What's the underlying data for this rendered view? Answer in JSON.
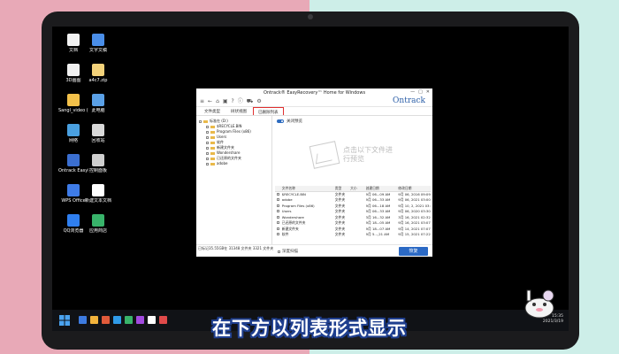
{
  "desktop": {
    "icons": [
      {
        "label": "文档",
        "color": "#f2f2f2"
      },
      {
        "label": "文字文稿",
        "color": "#4a8ee8"
      },
      {
        "label": "3D画图",
        "color": "#f0f0f0"
      },
      {
        "label": "a4c7.zip",
        "color": "#f3d27a"
      },
      {
        "label": "Sangl_video (192.168.1...",
        "color": "#f3c14a"
      },
      {
        "label": "此电脑",
        "color": "#5aa0e6"
      },
      {
        "label": "网络",
        "color": "#4aa0e0"
      },
      {
        "label": "回收站",
        "color": "#d8d8d8"
      },
      {
        "label": "Ontrack EasyReco...",
        "color": "#3b6fd0"
      },
      {
        "label": "控制面板",
        "color": "#cfcfcf"
      },
      {
        "label": "WPS Office",
        "color": "#3e7ce8"
      },
      {
        "label": "新建文本文档",
        "color": "#ffffff"
      },
      {
        "label": "QQ浏览器",
        "color": "#2f7ff0"
      },
      {
        "label": "应用商店",
        "color": "#38b36a"
      }
    ]
  },
  "window": {
    "title": "Ontrack® EasyRecovery™ Home for Windows",
    "controls": [
      "—",
      "□",
      "✕"
    ],
    "brand": "Ontrack",
    "toolbar_icons": [
      "menu-icon",
      "back-icon",
      "home-icon",
      "save-icon",
      "help-icon",
      "info-icon",
      "cart-icon",
      "settings-icon"
    ],
    "tabs": [
      {
        "label": "文件类型",
        "active": false
      },
      {
        "label": "树状视图",
        "active": false
      },
      {
        "label": "已删除列表",
        "active": true
      }
    ],
    "tree": [
      {
        "label": "标准在 (D:)",
        "indent": 0
      },
      {
        "label": "$RECYCLE.BIN",
        "indent": 2
      },
      {
        "label": "Program Files (x86)",
        "indent": 2
      },
      {
        "label": "Users",
        "indent": 2
      },
      {
        "label": "软件",
        "indent": 2
      },
      {
        "label": "新建文件夹",
        "indent": 2
      },
      {
        "label": "Wondershare",
        "indent": 2
      },
      {
        "label": "已还原的文件夹",
        "indent": 2
      },
      {
        "label": "adobe",
        "indent": 2
      }
    ],
    "left_status": "已标记35.55GB在 31348 文件夹 3321 文件夹",
    "preview_label": "关闭预览",
    "preview_message": "点击以下文件进行预览",
    "table": {
      "headers": [
        "",
        "文件名称",
        "类型",
        "大小",
        "创建日期",
        "修改日期"
      ],
      "rows": [
        {
          "name": "$RECYCLE.BIN",
          "type": "文件夹",
          "created": "9月 06...09 AM",
          "modified": "9月 06, 2016 09:09 AM"
        },
        {
          "name": "adobe",
          "type": "文件夹",
          "created": "9月 06...33 AM",
          "modified": "9月 06, 2021 03:00 AM"
        },
        {
          "name": "Program Files (x86)",
          "type": "文件夹",
          "created": "9月 06...18 AM",
          "modified": "9月 10, 2, 2021 03:00 AM"
        },
        {
          "name": "Users",
          "type": "文件夹",
          "created": "9月 06...33 AM",
          "modified": "9月 06, 2020 03:30 AM"
        },
        {
          "name": "Wondershare",
          "type": "文件夹",
          "created": "3月 16...32 AM",
          "modified": "3月 16, 2021 02:32 AM"
        },
        {
          "name": "已还原的文件夹",
          "type": "文件夹",
          "created": "9月 18...05 AM",
          "modified": "9月 16, 2021 03:07 AM"
        },
        {
          "name": "新建文件夹",
          "type": "文件夹",
          "created": "9月 18...07 AM",
          "modified": "9月 14, 2021 07:07 AM"
        },
        {
          "name": "软件",
          "type": "文件夹",
          "created": "9月 5...,21 AM",
          "modified": "9月 15, 2021 07:22 AM"
        }
      ]
    },
    "deep_scan_label": "深度扫描",
    "restore_button": "恢复"
  },
  "taskbar": {
    "apps": [
      "#3d7be0",
      "#f2b33c",
      "#e05a3a",
      "#2f9be8",
      "#38b36a",
      "#a24be0",
      "#ffffff",
      "#e04a4a"
    ],
    "time": "15:35",
    "date": "2021/3/19"
  },
  "subtitle": "在下方以列表形式显示"
}
